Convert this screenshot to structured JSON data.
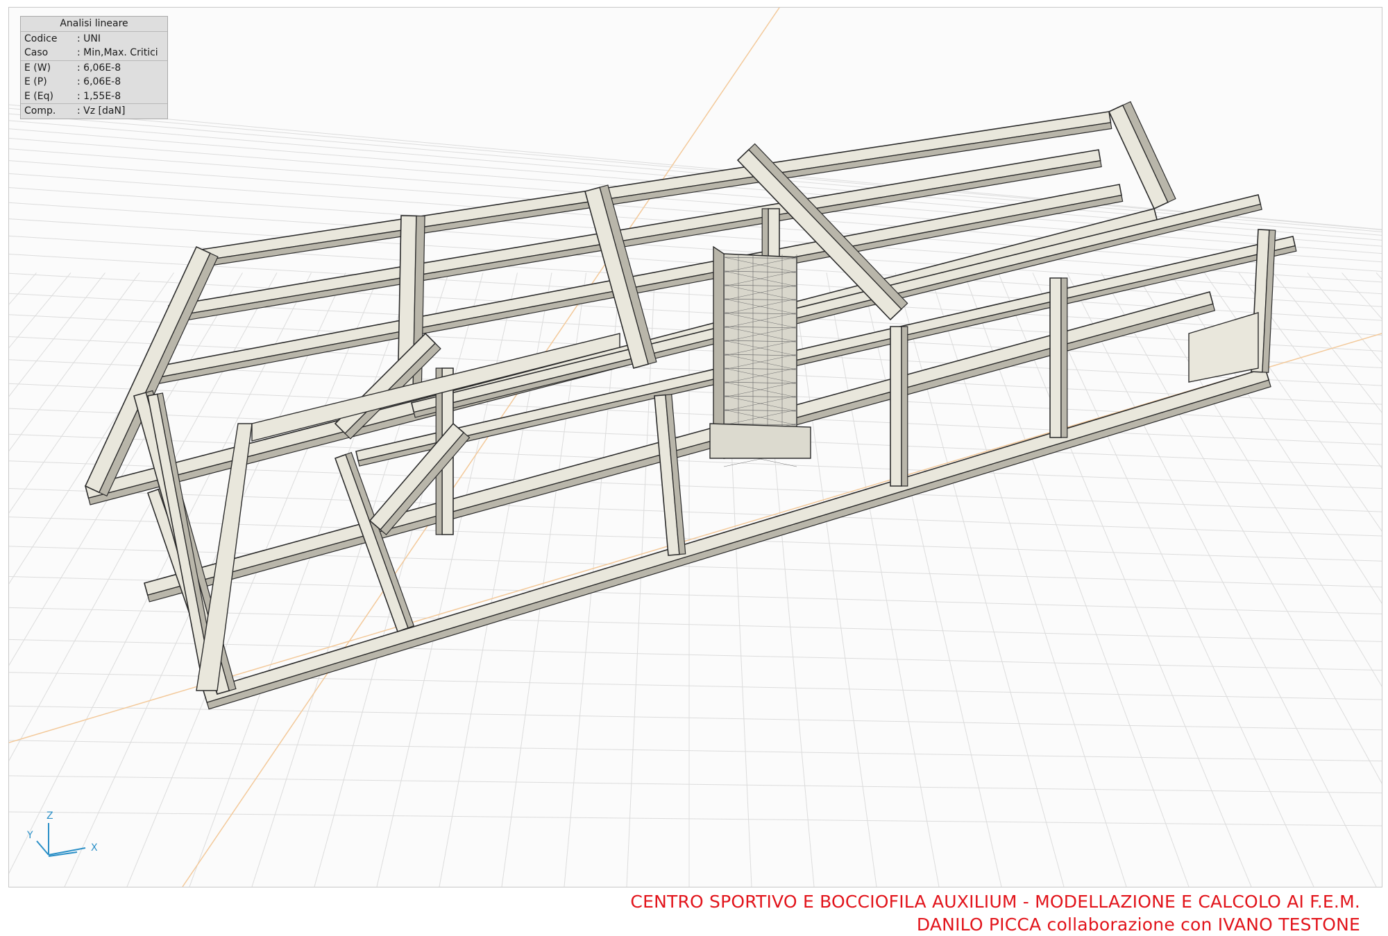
{
  "info": {
    "title": "Analisi lineare",
    "rows": [
      {
        "key": "Codice",
        "value": ": UNI"
      },
      {
        "key": "Caso",
        "value": ": Min,Max. Critici"
      },
      {
        "key": "E (W)",
        "value": ": 6,06E-8"
      },
      {
        "key": "E (P)",
        "value": ": 6,06E-8"
      },
      {
        "key": "E (Eq)",
        "value": ": 1,55E-8"
      },
      {
        "key": "Comp.",
        "value": ": Vz [daN]"
      }
    ]
  },
  "axes": {
    "x": "X",
    "y": "Y",
    "z": "Z",
    "color": "#2a8fc7"
  },
  "footer": {
    "line1": "CENTRO SPORTIVO E BOCCIOFILA AUXILIUM - MODELLAZIONE E CALCOLO AI F.E.M.",
    "line2": "DANILO PICCA collaborazione con IVANO TESTONE",
    "color": "#e2141b"
  },
  "model": {
    "fill": "#e9e7dc",
    "shade": "#b9b6aa",
    "dark": "#8d8a80",
    "edge": "#2b2b2b",
    "grid": "#dcdcdc",
    "axis_line": "#f3c99a",
    "mesh": "#6c6c6c"
  }
}
